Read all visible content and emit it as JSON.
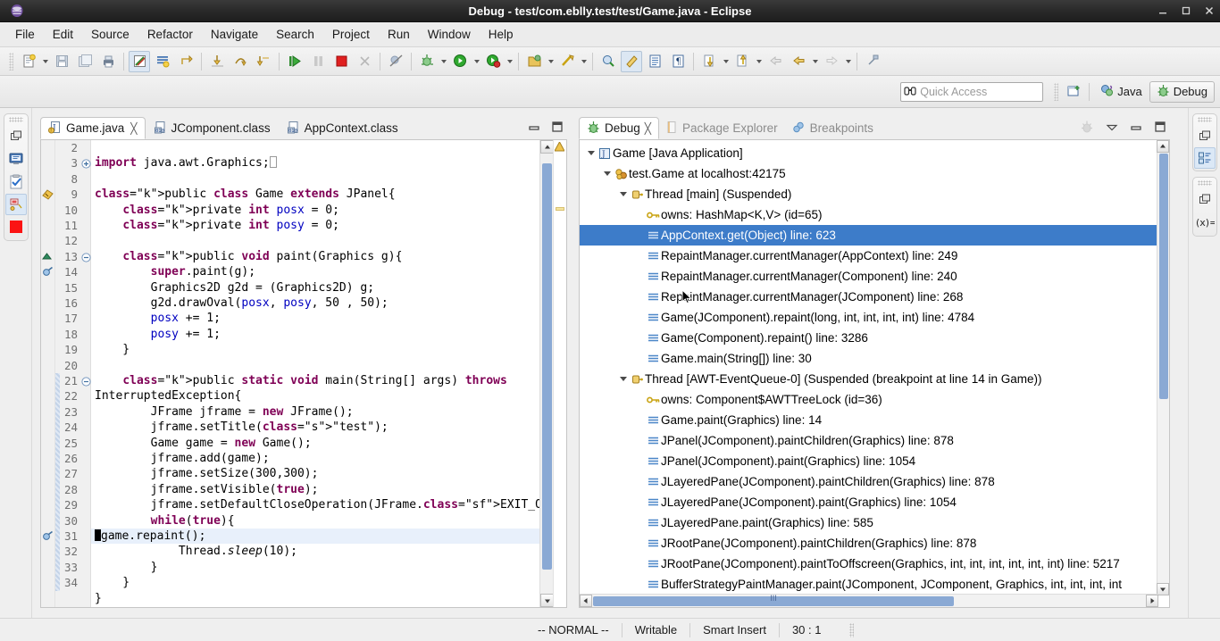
{
  "window": {
    "title": "Debug - test/com.eblly.test/test/Game.java - Eclipse",
    "minimize": "–",
    "maximize": "□",
    "close": "X"
  },
  "menubar": {
    "items": [
      "File",
      "Edit",
      "Source",
      "Refactor",
      "Navigate",
      "Search",
      "Project",
      "Run",
      "Window",
      "Help"
    ]
  },
  "quick_access": {
    "placeholder": "Quick Access"
  },
  "perspectives": [
    {
      "label": "Java",
      "active": false
    },
    {
      "label": "Debug",
      "active": true
    }
  ],
  "editor": {
    "tabs": [
      {
        "label": "Game.java",
        "active": true,
        "closable": true,
        "icon": "java-file-icon"
      },
      {
        "label": "JComponent.class",
        "active": false,
        "closable": false,
        "icon": "class-file-icon"
      },
      {
        "label": "AppContext.class",
        "active": false,
        "closable": false,
        "icon": "class-file-icon"
      }
    ],
    "minimize_label": "Minimize",
    "maximize_label": "Maximize",
    "lines": [
      {
        "num": "2",
        "fold": "",
        "marker": "",
        "text": "",
        "highlight": false,
        "changed": false
      },
      {
        "num": "3",
        "fold": "+",
        "marker": "",
        "text": "import java.awt.Graphics;",
        "highlight": false,
        "changed": false
      },
      {
        "num": "8",
        "fold": "",
        "marker": "",
        "text": "",
        "highlight": false,
        "changed": false
      },
      {
        "num": "9",
        "fold": "",
        "marker": "warning",
        "text": "public class Game extends JPanel{",
        "highlight": false,
        "changed": false
      },
      {
        "num": "10",
        "fold": "",
        "marker": "",
        "text": "    private int posx = 0;",
        "highlight": false,
        "changed": false
      },
      {
        "num": "11",
        "fold": "",
        "marker": "",
        "text": "    private int posy = 0;",
        "highlight": false,
        "changed": false
      },
      {
        "num": "12",
        "fold": "",
        "marker": "",
        "text": "",
        "highlight": false,
        "changed": false
      },
      {
        "num": "13",
        "fold": "-",
        "marker": "override",
        "text": "    public void paint(Graphics g){",
        "highlight": false,
        "changed": false
      },
      {
        "num": "14",
        "fold": "",
        "marker": "breakpoint",
        "text": "        super.paint(g);",
        "highlight": false,
        "changed": false
      },
      {
        "num": "15",
        "fold": "",
        "marker": "",
        "text": "        Graphics2D g2d = (Graphics2D) g;",
        "highlight": false,
        "changed": false
      },
      {
        "num": "16",
        "fold": "",
        "marker": "",
        "text": "        g2d.drawOval(posx, posy, 50 , 50);",
        "highlight": false,
        "changed": false
      },
      {
        "num": "17",
        "fold": "",
        "marker": "",
        "text": "        posx += 1;",
        "highlight": false,
        "changed": false
      },
      {
        "num": "18",
        "fold": "",
        "marker": "",
        "text": "        posy += 1;",
        "highlight": false,
        "changed": false
      },
      {
        "num": "19",
        "fold": "",
        "marker": "",
        "text": "    }",
        "highlight": false,
        "changed": false
      },
      {
        "num": "20",
        "fold": "",
        "marker": "",
        "text": "",
        "highlight": false,
        "changed": false
      },
      {
        "num": "21",
        "fold": "-",
        "marker": "",
        "text": "    public static void main(String[] args) throws",
        "highlight": false,
        "changed": true
      },
      {
        "num": "22",
        "fold": "",
        "marker": "",
        "text": "InterruptedException{",
        "highlight": false,
        "changed": true
      },
      {
        "num": "23",
        "fold": "",
        "marker": "",
        "text": "        JFrame jframe = new JFrame();",
        "highlight": false,
        "changed": true
      },
      {
        "num": "24",
        "fold": "",
        "marker": "",
        "text": "        jframe.setTitle(\"test\");",
        "highlight": false,
        "changed": true
      },
      {
        "num": "25",
        "fold": "",
        "marker": "",
        "text": "        Game game = new Game();",
        "highlight": false,
        "changed": true
      },
      {
        "num": "26",
        "fold": "",
        "marker": "",
        "text": "        jframe.add(game);",
        "highlight": false,
        "changed": true
      },
      {
        "num": "27",
        "fold": "",
        "marker": "",
        "text": "        jframe.setSize(300,300);",
        "highlight": false,
        "changed": true
      },
      {
        "num": "28",
        "fold": "",
        "marker": "",
        "text": "        jframe.setVisible(true);",
        "highlight": false,
        "changed": true
      },
      {
        "num": "29",
        "fold": "",
        "marker": "",
        "text": "        jframe.setDefaultCloseOperation(JFrame.EXIT_ON_CLOSE);",
        "highlight": false,
        "changed": true
      },
      {
        "num": "30",
        "fold": "",
        "marker": "",
        "text": "        while(true){",
        "highlight": false,
        "changed": true
      },
      {
        "num": "31",
        "fold": "",
        "marker": "breakpoint",
        "text": "            game.repaint();",
        "highlight": true,
        "changed": true
      },
      {
        "num": "32",
        "fold": "",
        "marker": "",
        "text": "            Thread.sleep(10);",
        "highlight": false,
        "changed": true
      },
      {
        "num": "33",
        "fold": "",
        "marker": "",
        "text": "        }",
        "highlight": false,
        "changed": true
      },
      {
        "num": "34",
        "fold": "",
        "marker": "",
        "text": "    }",
        "highlight": false,
        "changed": true
      },
      {
        "num": "",
        "fold": "",
        "marker": "",
        "text": "}",
        "highlight": false,
        "changed": false
      }
    ]
  },
  "debug_view": {
    "tabs": [
      {
        "label": "Debug",
        "active": true,
        "closable": true,
        "icon": "debug-icon"
      },
      {
        "label": "Package Explorer",
        "active": false,
        "closable": false,
        "icon": "package-explorer-icon"
      },
      {
        "label": "Breakpoints",
        "active": false,
        "closable": false,
        "icon": "breakpoints-icon"
      }
    ],
    "view_menu_label": "View Menu",
    "minimize_label": "Minimize",
    "maximize_label": "Maximize",
    "tree": [
      {
        "indent": 0,
        "twisty": "open",
        "icon": "launch-icon",
        "label": "Game [Java Application]",
        "selected": false
      },
      {
        "indent": 1,
        "twisty": "open",
        "icon": "vm-icon",
        "label": "test.Game at localhost:42175",
        "selected": false
      },
      {
        "indent": 2,
        "twisty": "open",
        "icon": "thread-icon",
        "label": "Thread [main] (Suspended)",
        "selected": false
      },
      {
        "indent": 3,
        "twisty": "none",
        "icon": "monitor-icon",
        "label": "owns: HashMap<K,V>  (id=65)",
        "selected": false
      },
      {
        "indent": 3,
        "twisty": "none",
        "icon": "stackframe-icon",
        "label": "AppContext.get(Object) line: 623",
        "selected": true
      },
      {
        "indent": 3,
        "twisty": "none",
        "icon": "stackframe-icon",
        "label": "RepaintManager.currentManager(AppContext) line: 249",
        "selected": false
      },
      {
        "indent": 3,
        "twisty": "none",
        "icon": "stackframe-icon",
        "label": "RepaintManager.currentManager(Component) line: 240",
        "selected": false
      },
      {
        "indent": 3,
        "twisty": "none",
        "icon": "stackframe-icon",
        "label": "RepaintManager.currentManager(JComponent) line: 268",
        "selected": false
      },
      {
        "indent": 3,
        "twisty": "none",
        "icon": "stackframe-icon",
        "label": "Game(JComponent).repaint(long, int, int, int, int) line: 4784",
        "selected": false
      },
      {
        "indent": 3,
        "twisty": "none",
        "icon": "stackframe-icon",
        "label": "Game(Component).repaint() line: 3286",
        "selected": false
      },
      {
        "indent": 3,
        "twisty": "none",
        "icon": "stackframe-icon",
        "label": "Game.main(String[]) line: 30",
        "selected": false
      },
      {
        "indent": 2,
        "twisty": "open",
        "icon": "thread-icon",
        "label": "Thread [AWT-EventQueue-0] (Suspended (breakpoint at line 14 in Game))",
        "selected": false
      },
      {
        "indent": 3,
        "twisty": "none",
        "icon": "monitor-icon",
        "label": "owns: Component$AWTTreeLock  (id=36)",
        "selected": false
      },
      {
        "indent": 3,
        "twisty": "none",
        "icon": "stackframe-icon",
        "label": "Game.paint(Graphics) line: 14",
        "selected": false
      },
      {
        "indent": 3,
        "twisty": "none",
        "icon": "stackframe-icon",
        "label": "JPanel(JComponent).paintChildren(Graphics) line: 878",
        "selected": false
      },
      {
        "indent": 3,
        "twisty": "none",
        "icon": "stackframe-icon",
        "label": "JPanel(JComponent).paint(Graphics) line: 1054",
        "selected": false
      },
      {
        "indent": 3,
        "twisty": "none",
        "icon": "stackframe-icon",
        "label": "JLayeredPane(JComponent).paintChildren(Graphics) line: 878",
        "selected": false
      },
      {
        "indent": 3,
        "twisty": "none",
        "icon": "stackframe-icon",
        "label": "JLayeredPane(JComponent).paint(Graphics) line: 1054",
        "selected": false
      },
      {
        "indent": 3,
        "twisty": "none",
        "icon": "stackframe-icon",
        "label": "JLayeredPane.paint(Graphics) line: 585",
        "selected": false
      },
      {
        "indent": 3,
        "twisty": "none",
        "icon": "stackframe-icon",
        "label": "JRootPane(JComponent).paintChildren(Graphics) line: 878",
        "selected": false
      },
      {
        "indent": 3,
        "twisty": "none",
        "icon": "stackframe-icon",
        "label": "JRootPane(JComponent).paintToOffscreen(Graphics, int, int, int, int, int, int) line: 5217",
        "selected": false
      },
      {
        "indent": 3,
        "twisty": "none",
        "icon": "stackframe-icon",
        "label": "BufferStrategyPaintManager.paint(JComponent, JComponent, Graphics, int, int, int, int",
        "selected": false
      }
    ]
  },
  "statusbar": {
    "vim_mode": "-- NORMAL --",
    "writable": "Writable",
    "insert_mode": "Smart Insert",
    "position": "30 : 1"
  },
  "left_shortcuts": [
    {
      "icon": "restore-icon",
      "name": "restore-icon"
    },
    {
      "icon": "console-icon",
      "name": "console-icon"
    },
    {
      "icon": "tasks-icon",
      "name": "tasks-icon"
    },
    {
      "icon": "debug-perspective-icon",
      "name": "debug-perspective-icon"
    },
    {
      "icon": "terminate-icon",
      "name": "terminate-icon"
    }
  ],
  "right_shortcuts": [
    {
      "icon": "restore-icon",
      "name": "restore-icon"
    },
    {
      "icon": "outline-icon",
      "name": "outline-icon"
    },
    {
      "icon": "restore-icon",
      "name": "restore-icon"
    },
    {
      "icon": "variables-icon",
      "name": "variables-icon"
    }
  ],
  "colors": {
    "selection": "#3d7cc9",
    "line_highlight": "#e8f0fb",
    "keyword": "#7f0055",
    "field": "#0000c0",
    "string": "#2a00ff",
    "titlebar": "#2b2b2b",
    "terminate_red": "#e81212"
  }
}
